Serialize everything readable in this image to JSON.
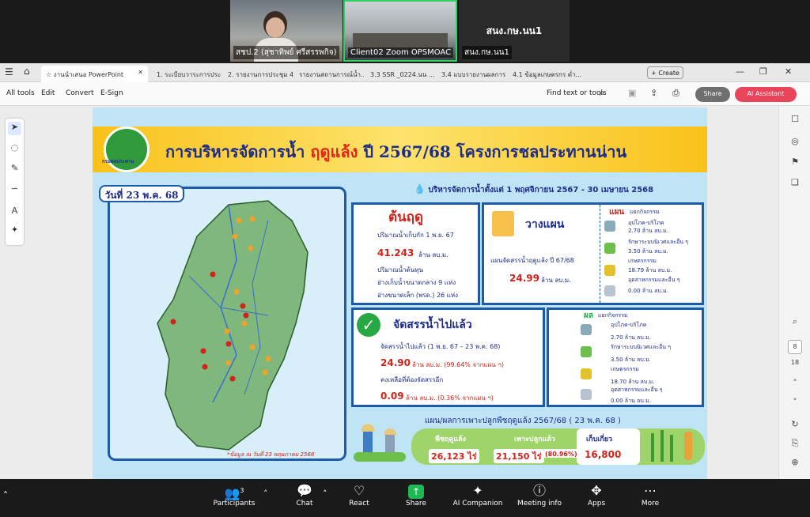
{
  "video": {
    "tile1_name": "สชป.2 (สุชาทิพย์ ศรีสรรพกิจ)",
    "tile2_name": "Client02 Zoom OPSMOAC",
    "tile3_display": "สนง.กษ.นน1",
    "tile3_name": "สนง.กษ.นน1"
  },
  "tabs": [
    {
      "label": "งานนำเสนอ PowerPoint"
    },
    {
      "label": "1. ระเบียบวาระการประชุม..."
    },
    {
      "label": "2. รายงานการประชุม 4..."
    },
    {
      "label": "รายงานสถานการณ์น้ำ..."
    },
    {
      "label": "3.3 SSR _0224.นน ..."
    },
    {
      "label": "3.4 แบบรายงานผลการ..."
    },
    {
      "label": "4.1 ข้อมูลเกษตรกร ต่ำ..."
    }
  ],
  "create_label": "+ Create",
  "toolbar": {
    "all_tools": "All tools",
    "edit": "Edit",
    "convert": "Convert",
    "esign": "E-Sign",
    "find": "Find text or tools",
    "share": "Share",
    "ai_assistant": "AI Assistant"
  },
  "page_nav": {
    "current": "8",
    "total": "18"
  },
  "slide": {
    "title_part1": "การบริหารจัดการน้ำ ",
    "title_part2": "ฤดูแล้ง",
    "title_part3": " ปี 2567/68 โครงการชลประทานน่าน",
    "logo_text": "กรมชลประทาน",
    "date": "วันที่ 23 พ.ค. 68",
    "subtitle": "บริหารจัดการน้ำตั้งแต่ 1 พฤศจิกายน 2567 - 30 เมษายน 2568",
    "map_note": "*ข้อมูล ณ วันที่ 23 พฤษภาคม 2568",
    "start": {
      "head": "ต้นฤดู",
      "line1": "ปริมาณน้ำเก็บกัก 1 พ.ย. 67",
      "value": "41.243",
      "unit": "ล้าน ลบ.ม.",
      "line2": "ปริมาณน้ำต้นทุน",
      "line3": "อ่างเก็บน้ำขนาดกลาง 9 แห่ง",
      "line4": "อ่างขนาดเล็ก (พรด.) 26 แห่ง"
    },
    "plan": {
      "head": "วางแผน",
      "line1": "แผนจัดสรรน้ำฤดูแล้ง ปี 67/68",
      "value": "24.99",
      "unit": "ล้าน ลบ.ม.",
      "tag": "แผน",
      "category_head": "แยกกิจกรรม",
      "items": [
        {
          "name": "อุปโภค-บริโภค",
          "value": "2.70 ล้าน ลบ.ม."
        },
        {
          "name": "รักษาระบบนิเวศและอื่น ๆ",
          "value": "3.50 ล้าน ลบ.ม."
        },
        {
          "name": "เกษตรกรรม",
          "value": "18.79 ล้าน ลบ.ม."
        },
        {
          "name": "อุตสาหกรรมและอื่น ๆ",
          "value": "0.00 ล้าน ลบ.ม."
        }
      ]
    },
    "alloc": {
      "head": "จัดสรรน้ำไปแล้ว",
      "line1": "จัดสรรน้ำไปแล้ว (1 พ.ย. 67 – 23 พ.ค. 68)",
      "value": "24.90",
      "detail": "ล้าน ลบ.ม. (99.64% จากแผน ฯ)",
      "remain_label": "คงเหลือที่ต้องจัดสรรอีก",
      "remain_value": "0.09",
      "remain_detail": "ล้าน ลบ.ม. (0.36% จากแผน ฯ)"
    },
    "result": {
      "tag": "ผล",
      "category_head": "แยกกิจกรรม",
      "items": [
        {
          "name": "อุปโภค-บริโภค",
          "value": "2.70 ล้าน ลบ.ม."
        },
        {
          "name": "รักษาระบบนิเวศและอื่น ๆ",
          "value": "3.50 ล้าน ลบ.ม."
        },
        {
          "name": "เกษตรกรรม",
          "value": "18.70 ล้าน ลบ.ม."
        },
        {
          "name": "อุตสาหกรรมและอื่น ๆ",
          "value": "0.00 ล้าน ลบ.ม."
        }
      ]
    },
    "crop": {
      "title": "แผน/ผลการเพาะปลูกพืชฤดูแล้ง 2567/68 ( 23 พ.ค. 68 )",
      "plan_label": "พืชฤดูแล้ง",
      "plan_value": "26,123 ไร่",
      "planted_label": "เพาะปลูกแล้ว",
      "planted_value": "21,150 ไร่",
      "planted_pct": "(80.96%)",
      "harvest_label": "เก็บเกี่ยว",
      "harvest_value": "16,800"
    }
  },
  "zoom": {
    "participants_label": "Participants",
    "participants_count": "3",
    "chat": "Chat",
    "react": "React",
    "share": "Share",
    "ai_companion": "AI Companion",
    "meeting_info": "Meeting info",
    "apps": "Apps",
    "more": "More"
  }
}
